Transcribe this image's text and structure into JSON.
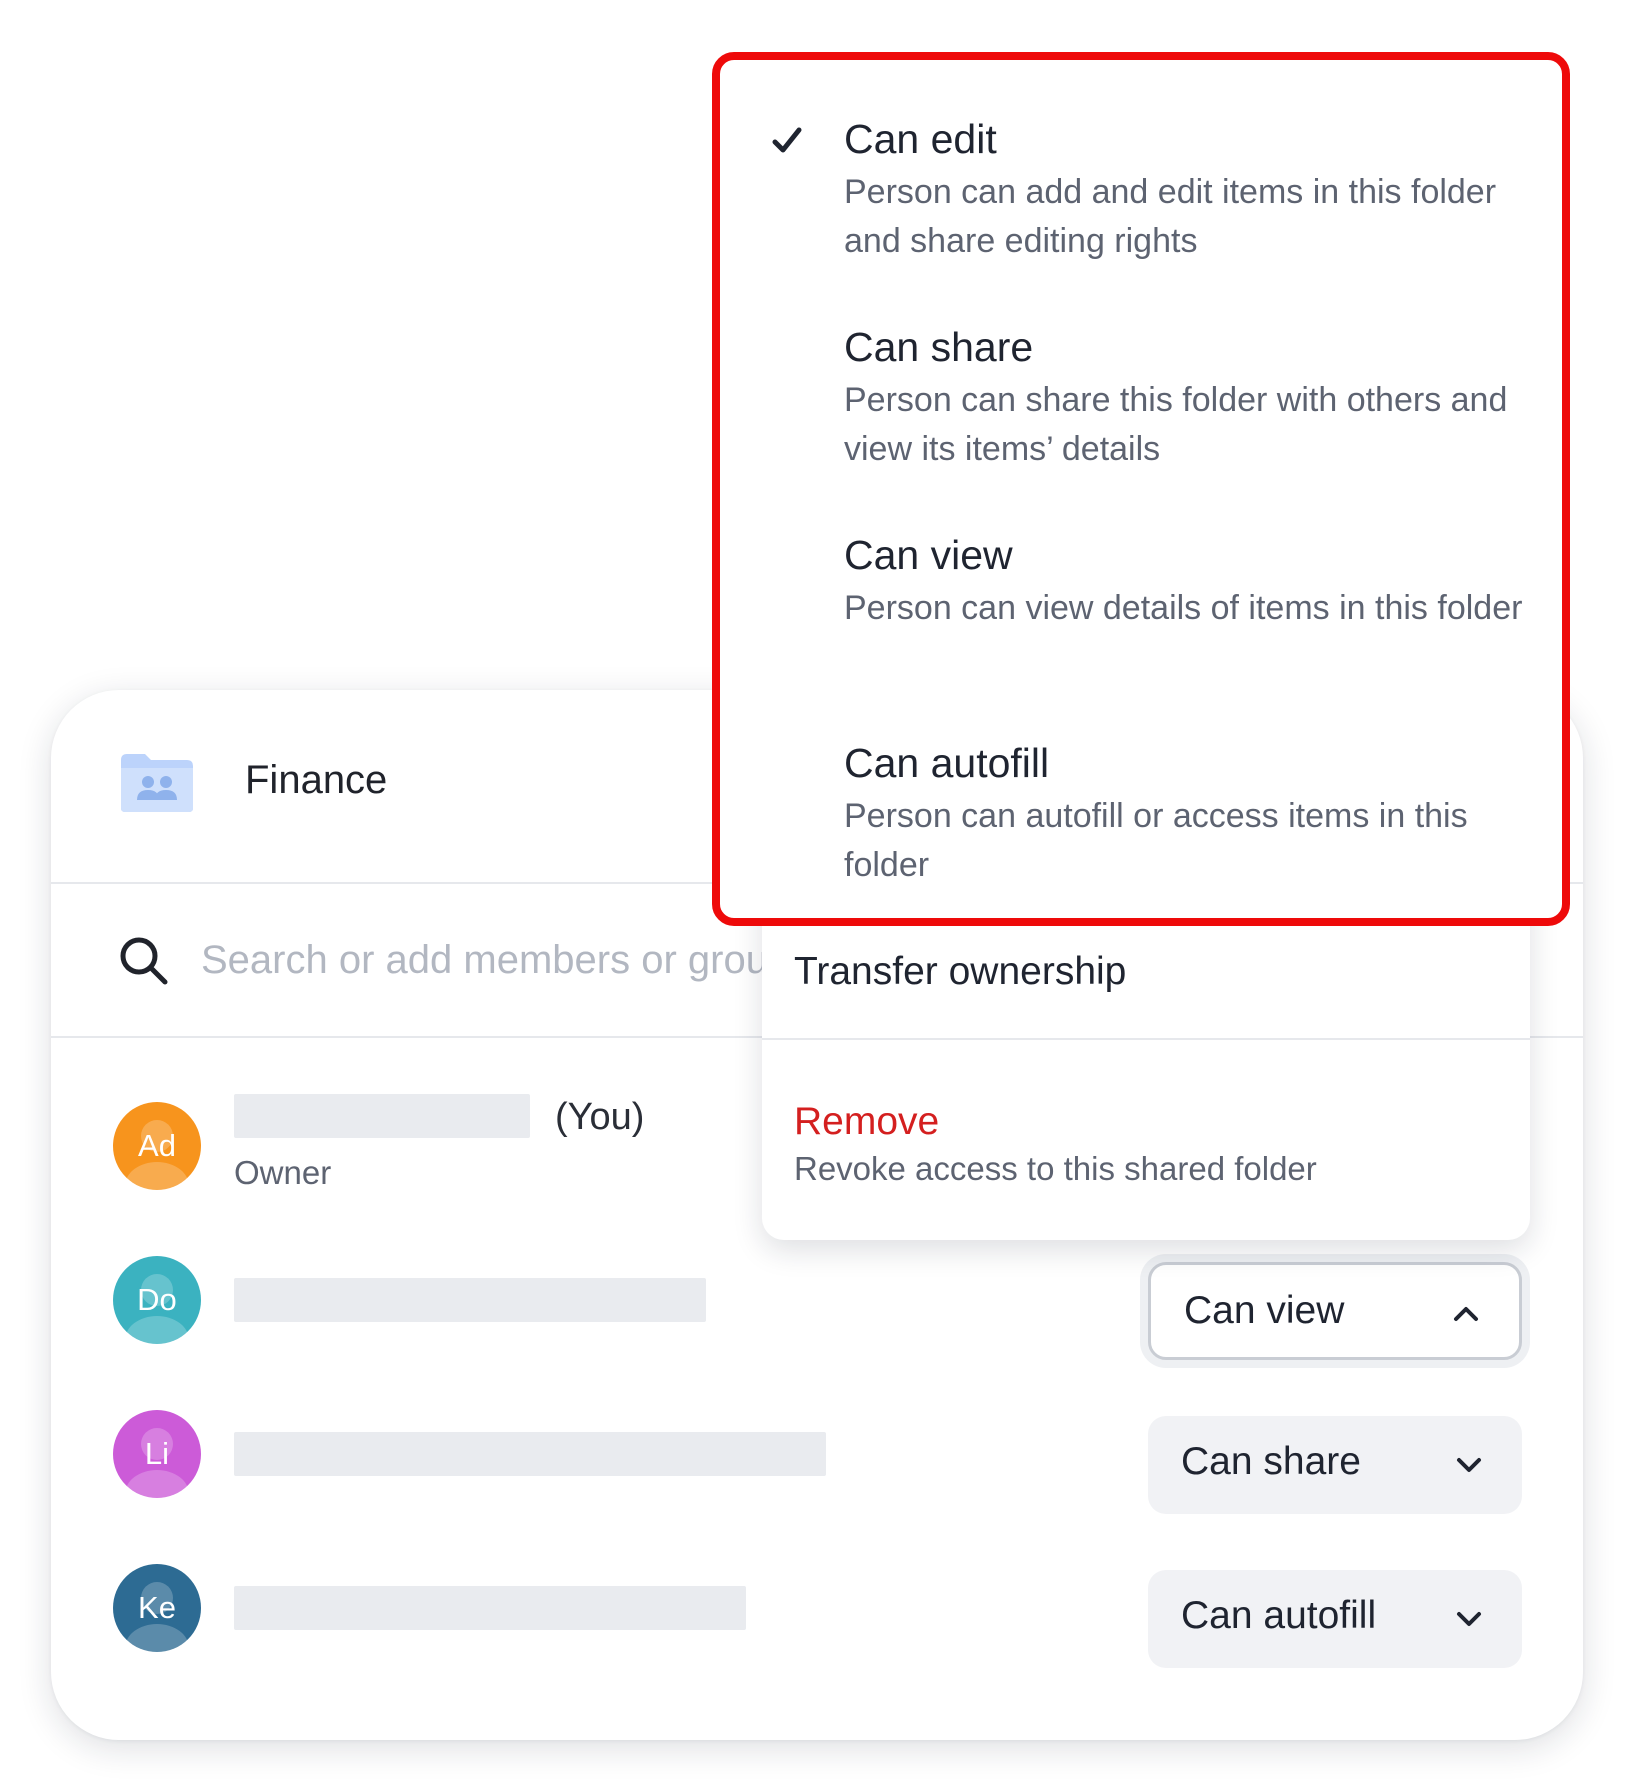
{
  "folder": {
    "title": "Finance",
    "icon": "shared-folder-icon",
    "color": "#bcd3fb"
  },
  "search": {
    "placeholder": "Search or add members or groups",
    "icon": "search-icon"
  },
  "members": [
    {
      "initials": "Ad",
      "color": "#f7941d",
      "you_label": "(You)",
      "role": "Owner"
    },
    {
      "initials": "Do",
      "color": "#3bb2c0",
      "permission": "Can view",
      "expanded": true
    },
    {
      "initials": "Li",
      "color": "#cc5bd8",
      "permission": "Can share",
      "expanded": false
    },
    {
      "initials": "Ke",
      "color": "#2d6b93",
      "permission": "Can autofill",
      "expanded": false
    }
  ],
  "menu": {
    "transfer_label": "Transfer ownership",
    "remove_label": "Remove",
    "remove_desc": "Revoke access to this shared folder",
    "remove_color": "#d41f1f"
  },
  "dropdown": {
    "highlight_color": "#ee0a0a",
    "options": [
      {
        "title": "Can edit",
        "desc": "Person can add and edit items in this folder and share editing rights",
        "selected": true
      },
      {
        "title": "Can share",
        "desc": "Person can share this folder with others and view its items’ details",
        "selected": false
      },
      {
        "title": "Can view",
        "desc": "Person can view details of items in this folder",
        "selected": false
      },
      {
        "title": "Can autofill",
        "desc": "Person can autofill or access items in this folder",
        "selected": false
      }
    ]
  }
}
